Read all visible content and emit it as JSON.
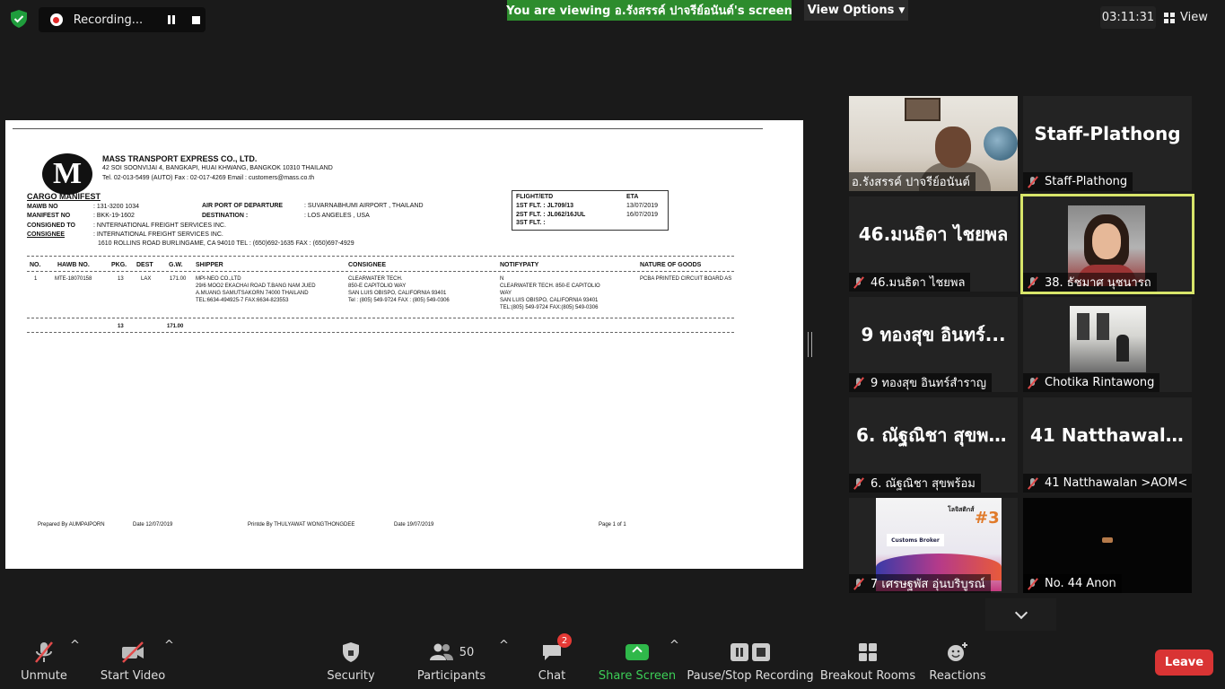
{
  "top_bar": {
    "recording_label": "Recording...",
    "viewing_banner": "You are viewing อ.รังสรรค์ ปาจรีย์อนันต์'s screen",
    "view_options_label": "View Options",
    "timer": "03:11:31",
    "view_label": "View"
  },
  "document": {
    "company_name": "MASS TRANSPORT EXPRESS CO., LTD.",
    "company_address": "42 SOI SOONVIJAI 4, BANGKAPI, HUAI KHWANG,  BANGKOK 10310 THAILAND",
    "company_contact": "Tel. 02-013-5499 (AUTO) Fax : 02-017-4269   Email : customers@mass.co.th",
    "title": "CARGO MANIFEST",
    "mawb_label": "MAWB NO",
    "mawb_value": ": 131-3200 1034",
    "manifest_label": "MANIFEST NO",
    "manifest_value": ": BKK-19-1602",
    "consigned_to_label": "CONSIGNED TO",
    "consigned_to_value": ": NNTERNATIONAL FREIGHT SERVICES INC.",
    "consignee_label": "CONSIGNEE",
    "consignee_value": ": INTERNATIONAL FREIGHT SERVICES INC.",
    "consignee_address": "1610 ROLLINS ROAD BURLINGAME, CA 94010 TEL : (650)692-1635        FAX : (650)697-4929",
    "departure_label": "AIR PORT OF DEPARTURE",
    "departure_value": ": SUVARNABHUMI AIRPORT , THAILAND",
    "destination_label": "DESTINATION :",
    "destination_value": ": LOS ANGELES , USA",
    "flight_header": "FLIGHT/ETD",
    "eta_header": "ETA",
    "flight1": "1ST FLT. :  JL709/13",
    "eta1": "13/07/2019",
    "flight2": "2ST FLT. :  JL062/16JUL",
    "eta2": "16/07/2019",
    "flight3": "3ST FLT. :",
    "headers": [
      "NO.",
      "HAWB NO.",
      "PKG.",
      "DEST",
      "G.W.",
      "SHIPPER",
      "CONSIGNEE",
      "NOTIFYPATY",
      "NATURE OF GOODS"
    ],
    "row": {
      "no": "1",
      "hawb": "MTE-18070158",
      "pkg": "13",
      "dest": "LAX",
      "gw": "171.00",
      "shipper1": "MPI-NEO CO.,LTD",
      "shipper2": "29/6 MOO2 EKACHAI ROAD T.BANG NAM JUED",
      "shipper3": "A.MUANG SAMUTSAKORN 74000 THAILAND",
      "shipper4": "TEL:6634-494925-7  FAX:6634-823553",
      "consignee1": "CLEARWATER TECH.",
      "consignee2": "850-E CAPITOLIO WAY",
      "consignee3": "SAN LUIS OBISPO, CALIFORNIA  93401",
      "consignee4": "Tel : (805) 549-9724     FAX : (805) 549-0306",
      "notify1": "N",
      "notify2": "CLEARWATER TECH. 850-E CAPITOLIO",
      "notify3": "WAY",
      "notify4": "SAN LUIS OBISPO, CALIFORNIA 93401",
      "notify5": "TEL:(805) 549-9724 FAX:(805) 549-0306",
      "goods": "PCBA PRINTED CIRCUIT BOARD AS"
    },
    "total_pkg": "13",
    "total_gw": "171.00",
    "prepared_by": "Prepared By AUMPAIPORN",
    "prepared_date": "Date 12/07/2019",
    "printed_by": "Printde By THULYAWAT WONGTHONGDEE",
    "printed_date": "Date 19/07/2019",
    "page": "Page 1 of 1"
  },
  "participants": [
    {
      "big": "",
      "label": "อ.รังสรรค์ ปาจรีย์อนันต์",
      "muted": false,
      "video": "man"
    },
    {
      "big": "Staff-Plathong",
      "label": "Staff-Plathong",
      "muted": true
    },
    {
      "big": "46.มนธิดา ไชยพล",
      "label": "46.มนธิดา ไชยพล",
      "muted": true
    },
    {
      "big": "",
      "label": "38. ธัชมาศ นุชนารถ",
      "muted": true,
      "video": "woman",
      "active": true
    },
    {
      "big": "9 ทองสุข อินทร์...",
      "label": "9 ทองสุข อินทร์สำราญ",
      "muted": true
    },
    {
      "big": "",
      "label": "Chotika Rintawong",
      "muted": true,
      "video": "room"
    },
    {
      "big": "6. ณัฐณิชา สุขพร้...",
      "label": "6. ณัฐณิชา สุขพร้อม",
      "muted": true
    },
    {
      "big": "41  Natthawalan...",
      "label": "41 Natthawalan >AOM<",
      "muted": true
    },
    {
      "big": "",
      "label": "7 เศรษฐพัส อุ่นบริบูรณ์",
      "muted": true,
      "video": "poster"
    },
    {
      "big": "",
      "label": "No. 44 Anon",
      "muted": true,
      "video": "dark"
    }
  ],
  "poster": {
    "header": "โลจิสติกส์",
    "box": "Customs Broker",
    "number": "#3"
  },
  "toolbar": {
    "unmute": "Unmute",
    "start_video": "Start Video",
    "security": "Security",
    "participants": "Participants",
    "participants_count": "50",
    "chat": "Chat",
    "chat_badge": "2",
    "share_screen": "Share Screen",
    "pause_stop": "Pause/Stop Recording",
    "breakout": "Breakout Rooms",
    "reactions": "Reactions",
    "leave": "Leave"
  },
  "colors": {
    "banner": "#2d8c2d",
    "leave": "#d93434",
    "share": "#2fb84a",
    "active_speaker": "#d8e56a"
  },
  "icons": [
    "shield-check-icon",
    "record-icon",
    "pause-icon",
    "stop-icon",
    "grid-icon",
    "mic-off-icon",
    "video-off-icon",
    "shield-icon",
    "people-icon",
    "chat-icon",
    "share-screen-icon",
    "breakout-rooms-icon",
    "reactions-icon",
    "chevron-down-icon"
  ]
}
